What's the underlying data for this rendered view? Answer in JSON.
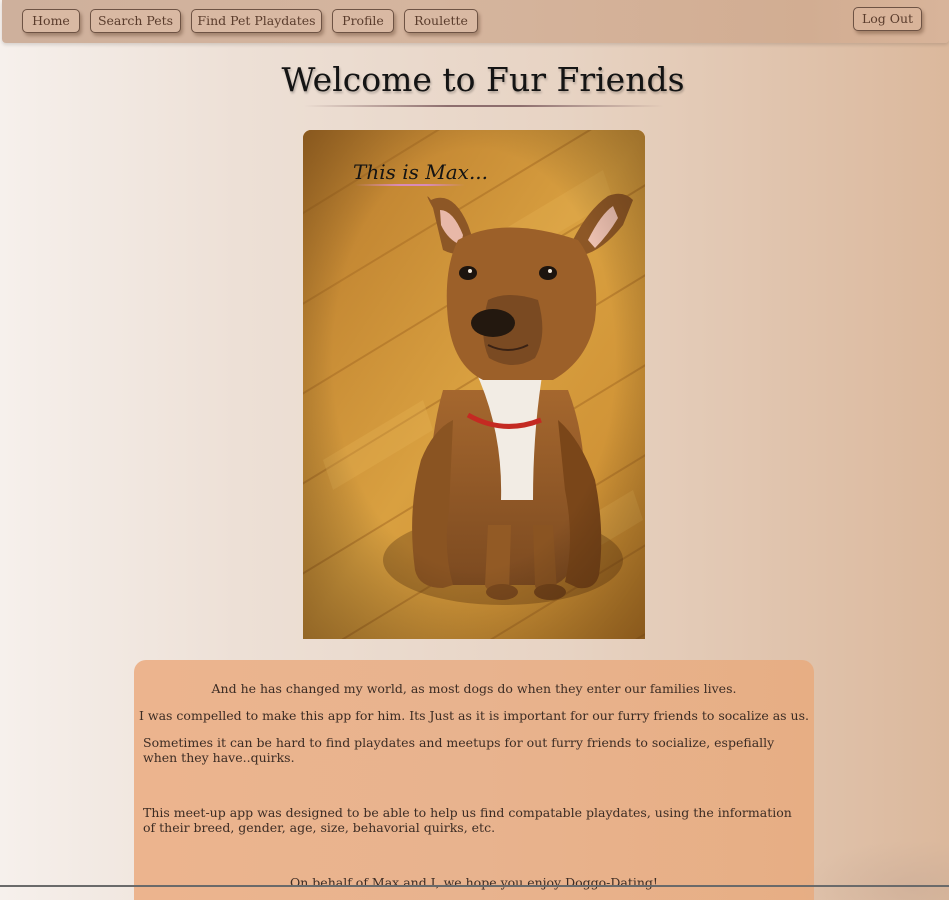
{
  "nav": {
    "items": [
      {
        "label": "Home"
      },
      {
        "label": "Search Pets"
      },
      {
        "label": "Find Pet Playdates"
      },
      {
        "label": "Profile"
      },
      {
        "label": "Roulette"
      }
    ],
    "logout_label": "Log Out"
  },
  "main": {
    "title": "Welcome to Fur Friends",
    "photo_caption": "This is Max...",
    "photo_subject": "dog-photo",
    "paragraphs": [
      "And he has changed my world, as most dogs do when they enter our families lives.",
      "I was compelled to make this app for him. Its Just as it is important for our furry friends to socalize as us.",
      "Sometimes it can be hard to find playdates and meetups for out furry friends to socialize, espefially when they have..quirks.",
      "This meet-up app was designed to be able to help us find compatable playdates, using the information of their breed, gender, age, size, behavorial quirks, etc.",
      "On behalf of Max and I, we hope you enjoy Doggo-Dating!"
    ]
  },
  "colors": {
    "navbar": "#d5b59e",
    "button_fill": "#d9b9a3",
    "button_border": "#6e5344",
    "card": "#e8b38e",
    "page_bg_left": "#f6f0ec",
    "page_bg_right": "#dbb89c"
  }
}
